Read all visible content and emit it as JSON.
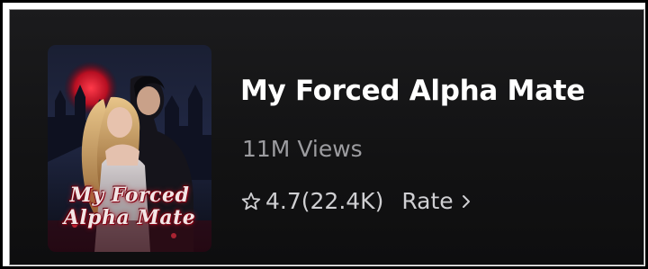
{
  "book": {
    "title": "My Forced Alpha Mate",
    "views": "11M Views",
    "rating": "4.7(22.4K)",
    "rate_label": "Rate",
    "cover": {
      "title_line1": "My Forced",
      "title_line2": "Alpha Mate"
    }
  },
  "icons": {
    "rating": "star-outline-icon",
    "rate": "chevron-right-icon"
  },
  "colors": {
    "background": "#141415",
    "title": "#ffffff",
    "secondary_text": "#9c9ca0",
    "accent_red": "#c21a2c"
  }
}
